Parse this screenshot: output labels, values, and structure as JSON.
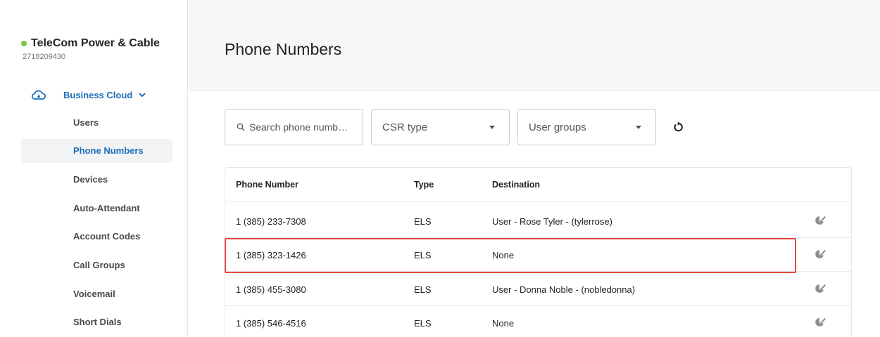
{
  "org": {
    "name": "TeleCom Power & Cable",
    "id": "2718209430"
  },
  "sidebar": {
    "section_label": "Business Cloud",
    "items": [
      {
        "label": "Users"
      },
      {
        "label": "Phone Numbers"
      },
      {
        "label": "Devices"
      },
      {
        "label": "Auto-Attendant"
      },
      {
        "label": "Account Codes"
      },
      {
        "label": "Call Groups"
      },
      {
        "label": "Voicemail"
      },
      {
        "label": "Short Dials"
      }
    ]
  },
  "page": {
    "title": "Phone Numbers"
  },
  "filters": {
    "search_placeholder": "Search phone numb…",
    "csr_type": "CSR type",
    "user_groups": "User groups"
  },
  "table": {
    "headers": {
      "number": "Phone Number",
      "type": "Type",
      "destination": "Destination"
    },
    "rows": [
      {
        "number": "1 (385) 233-7308",
        "type": "ELS",
        "destination": "User - Rose Tyler - (tylerrose)"
      },
      {
        "number": "1 (385) 323-1426",
        "type": "ELS",
        "destination": "None"
      },
      {
        "number": "1 (385) 455-3080",
        "type": "ELS",
        "destination": "User - Donna Noble - (nobledonna)"
      },
      {
        "number": "1 (385) 546-4516",
        "type": "ELS",
        "destination": "None"
      }
    ]
  },
  "colors": {
    "accent": "#1d6fb8",
    "status": "#7cc443",
    "highlight": "#e1473f"
  },
  "icons": [
    "cloud-icon",
    "chevron-down-icon",
    "search-icon",
    "reset-icon",
    "edit-location-icon"
  ]
}
